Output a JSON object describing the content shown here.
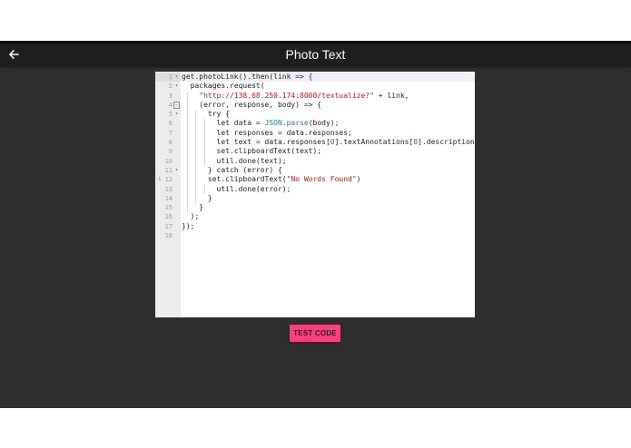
{
  "header": {
    "title": "Photo Text",
    "back_icon": "arrow-left-icon"
  },
  "colors": {
    "app_background": "#2f2f2f",
    "header_background": "#1e1e1e",
    "accent": "#ff3e7f",
    "string": "#c41a16",
    "builtin": "#1a7db0"
  },
  "editor": {
    "lines": [
      {
        "num": "1",
        "fold": "▾",
        "code": [
          {
            "t": "get.photoLink().then(link => {"
          }
        ]
      },
      {
        "num": "2",
        "fold": "▾",
        "code": [
          {
            "t": "  packages.request("
          }
        ]
      },
      {
        "num": "3",
        "code": [
          {
            "t": "    "
          },
          {
            "t": "\"http://138.68.250.174:8000/textualize?\"",
            "c": "str"
          },
          {
            "t": " + link,"
          }
        ]
      },
      {
        "num": "4",
        "fold": "−",
        "fold_boxed": true,
        "code": [
          {
            "t": "    (error, response, body) => {"
          }
        ]
      },
      {
        "num": "5",
        "fold": "▾",
        "code": [
          {
            "t": "      try {"
          }
        ]
      },
      {
        "num": "6",
        "code": [
          {
            "t": "        let data = "
          },
          {
            "t": "JSON",
            "c": "fn"
          },
          {
            "t": "."
          },
          {
            "t": "parse",
            "c": "fn"
          },
          {
            "t": "(body);"
          }
        ]
      },
      {
        "num": "7",
        "code": [
          {
            "t": "        let responses = data.responses;"
          }
        ]
      },
      {
        "num": "8",
        "code": [
          {
            "t": "        let text = data.responses["
          },
          {
            "t": "0",
            "c": "num"
          },
          {
            "t": "].textAnnotations["
          },
          {
            "t": "0",
            "c": "num"
          },
          {
            "t": "].description;"
          }
        ]
      },
      {
        "num": "9",
        "code": [
          {
            "t": "        set.clipboardText(text);"
          }
        ]
      },
      {
        "num": "10",
        "code": [
          {
            "t": "        util.done(text);"
          }
        ]
      },
      {
        "num": "11",
        "fold": "▾",
        "code": [
          {
            "t": "      } catch (error) {"
          }
        ]
      },
      {
        "num": "12",
        "warn": "i",
        "code": [
          {
            "t": "      set.clipboardText("
          },
          {
            "t": "\"No Words Found\"",
            "c": "str"
          },
          {
            "t": ")"
          }
        ]
      },
      {
        "num": "13",
        "code": [
          {
            "t": "        util.done(error);"
          }
        ]
      },
      {
        "num": "14",
        "code": [
          {
            "t": "      }"
          }
        ]
      },
      {
        "num": "15",
        "code": [
          {
            "t": "    }"
          }
        ]
      },
      {
        "num": "16",
        "code": [
          {
            "t": "  );"
          }
        ]
      },
      {
        "num": "17",
        "code": [
          {
            "t": "});"
          }
        ]
      },
      {
        "num": "18",
        "code": [
          {
            "t": ""
          }
        ]
      }
    ],
    "active_line": 1
  },
  "actions": {
    "test_label": "TEST CODE"
  }
}
